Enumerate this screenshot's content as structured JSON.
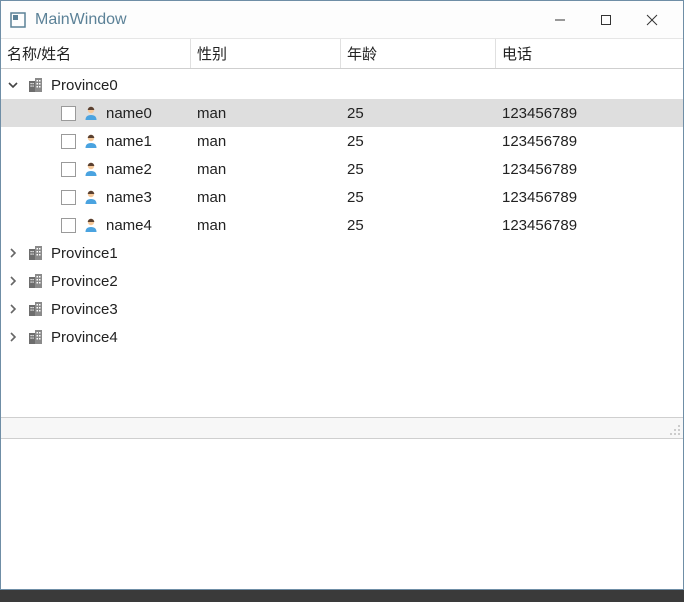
{
  "window": {
    "title": "MainWindow"
  },
  "columns": {
    "name": "名称/姓名",
    "sex": "性别",
    "age": "年龄",
    "phone": "电话"
  },
  "tree": [
    {
      "label": "Province0",
      "expanded": true,
      "children": [
        {
          "name": "name0",
          "sex": "man",
          "age": "25",
          "phone": "123456789",
          "selected": true
        },
        {
          "name": "name1",
          "sex": "man",
          "age": "25",
          "phone": "123456789",
          "selected": false
        },
        {
          "name": "name2",
          "sex": "man",
          "age": "25",
          "phone": "123456789",
          "selected": false
        },
        {
          "name": "name3",
          "sex": "man",
          "age": "25",
          "phone": "123456789",
          "selected": false
        },
        {
          "name": "name4",
          "sex": "man",
          "age": "25",
          "phone": "123456789",
          "selected": false
        }
      ]
    },
    {
      "label": "Province1",
      "expanded": false,
      "children": []
    },
    {
      "label": "Province2",
      "expanded": false,
      "children": []
    },
    {
      "label": "Province3",
      "expanded": false,
      "children": []
    },
    {
      "label": "Province4",
      "expanded": false,
      "children": []
    }
  ]
}
